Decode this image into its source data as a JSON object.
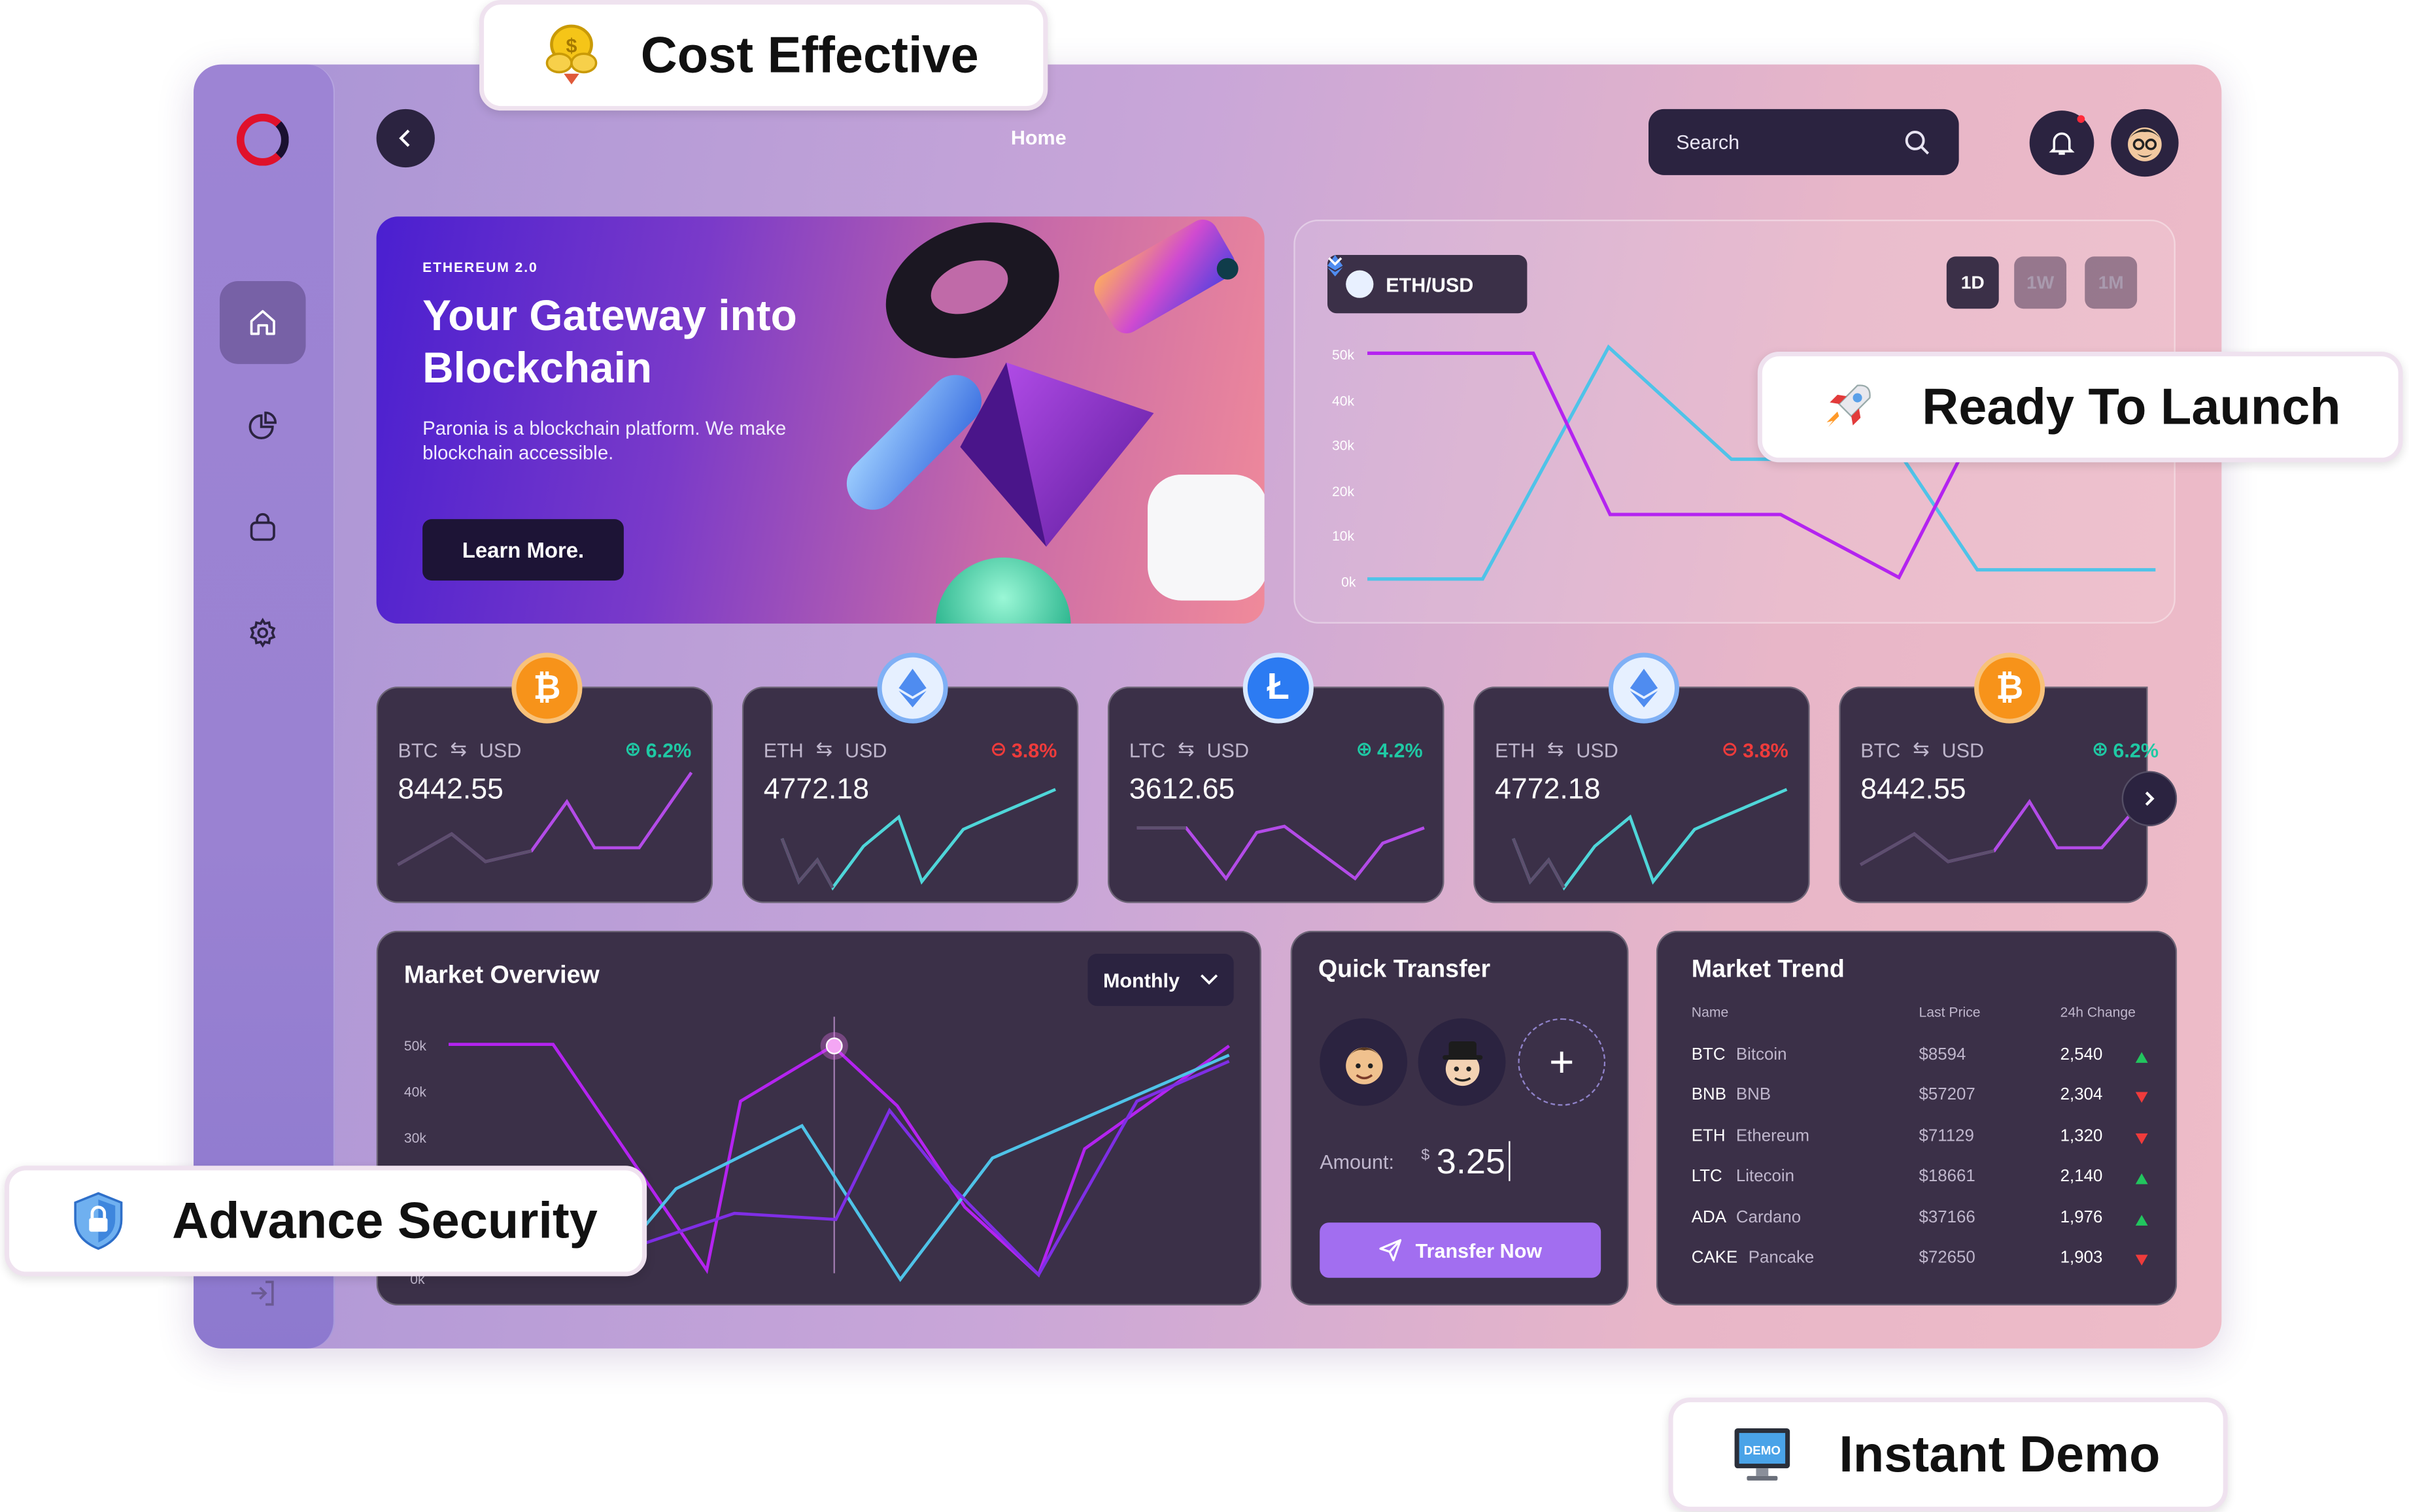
{
  "badges": {
    "cost": "Cost Effective",
    "launch": "Ready To Launch",
    "security": "Advance Security",
    "demo": "Instant Demo",
    "demo_screen_text": "DEMO"
  },
  "header": {
    "title": "Home",
    "search_placeholder": "Search"
  },
  "sidebar": {
    "items": [
      "home-icon",
      "pie-chart-icon",
      "wallet-icon",
      "gear-icon",
      "logout-icon"
    ]
  },
  "hero": {
    "tag": "ETHEREUM 2.0",
    "title": "Your Gateway into Blockchain",
    "description": "Paronia is a blockchain platform. We make blockchain accessible.",
    "button": "Learn More."
  },
  "price_chart": {
    "pair": "ETH/USD",
    "timeframes": [
      "1D",
      "1W",
      "1M"
    ],
    "active_timeframe": "1D",
    "y_ticks": [
      "50k",
      "40k",
      "30k",
      "20k",
      "10k",
      "0k"
    ]
  },
  "tickers": [
    {
      "base": "BTC",
      "quote": "USD",
      "change": "6.2%",
      "direction": "up",
      "value": "8442.55",
      "coin_color": "#f7931a",
      "line_color": "#b34be8",
      "symbol": "₿"
    },
    {
      "base": "ETH",
      "quote": "USD",
      "change": "3.8%",
      "direction": "down",
      "value": "4772.18",
      "coin_color": "#e6f0ff",
      "line_color": "#4fd6d9",
      "symbol": "♦"
    },
    {
      "base": "LTC",
      "quote": "USD",
      "change": "4.2%",
      "direction": "up",
      "value": "3612.65",
      "coin_color": "#2c7bf2",
      "line_color": "#b34be8",
      "symbol": "Ł"
    },
    {
      "base": "ETH",
      "quote": "USD",
      "change": "3.8%",
      "direction": "down",
      "value": "4772.18",
      "coin_color": "#e6f0ff",
      "line_color": "#4fd6d9",
      "symbol": "♦"
    },
    {
      "base": "BTC",
      "quote": "USD",
      "change": "6.2%",
      "direction": "up",
      "value": "8442.55",
      "coin_color": "#f7931a",
      "line_color": "#b34be8",
      "symbol": "₿"
    }
  ],
  "market_overview": {
    "title": "Market Overview",
    "period": "Monthly",
    "y_ticks": [
      "50k",
      "40k",
      "30k",
      "0k"
    ]
  },
  "quick_transfer": {
    "title": "Quick Transfer",
    "amount_label": "Amount:",
    "currency": "$",
    "amount": "3.25",
    "button": "Transfer Now"
  },
  "market_trend": {
    "title": "Market Trend",
    "columns": [
      "Name",
      "Last Price",
      "24h Change"
    ],
    "rows": [
      {
        "symbol": "BTC",
        "name": "Bitcoin",
        "price": "$8594",
        "change": "2,540",
        "direction": "up"
      },
      {
        "symbol": "BNB",
        "name": "BNB",
        "price": "$57207",
        "change": "2,304",
        "direction": "down"
      },
      {
        "symbol": "ETH",
        "name": "Ethereum",
        "price": "$71129",
        "change": "1,320",
        "direction": "down"
      },
      {
        "symbol": "LTC",
        "name": "Litecoin",
        "price": "$18661",
        "change": "2,140",
        "direction": "up"
      },
      {
        "symbol": "ADA",
        "name": "Cardano",
        "price": "$37166",
        "change": "1,976",
        "direction": "up"
      },
      {
        "symbol": "CAKE",
        "name": "Pancake",
        "price": "$72650",
        "change": "1,903",
        "direction": "down"
      }
    ]
  },
  "colors": {
    "panel": "#3b3048",
    "accent_purple": "#b423f0",
    "accent_cyan": "#4fc3e8",
    "up": "#1fc9a4",
    "down": "#ef3b3b",
    "button": "#a26ef0"
  }
}
